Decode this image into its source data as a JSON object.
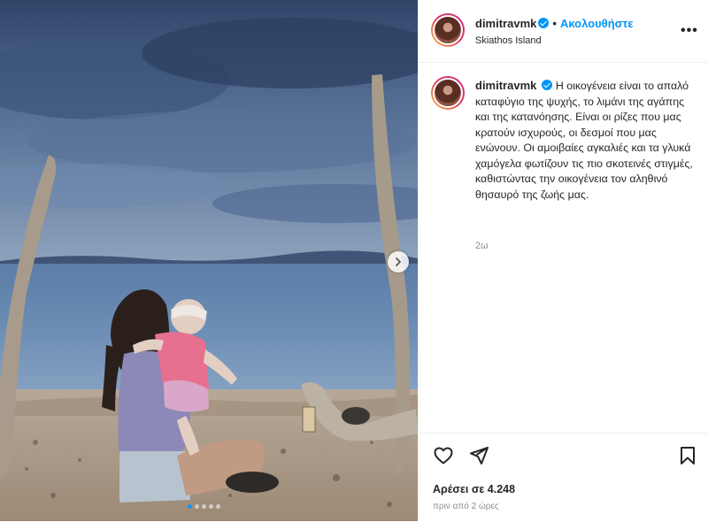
{
  "header": {
    "username": "dimitravmk",
    "separator": "•",
    "follow_label": "Ακολουθήστε",
    "location": "Skiathos Island",
    "more_label": "•••"
  },
  "caption": {
    "username": "dimitravmk",
    "text": "Η οικογένεια είναι το απαλό καταφύγιο της ψυχής, το λιμάνι της αγάπης και της κατανόησης. Είναι οι ρίζες που μας κρατούν ισχυρούς, οι δεσμοί που μας ενώνουν. Οι αμοιβαίες αγκαλιές και τα γλυκά χαμόγελα φωτίζουν τις πιο σκοτεινές στιγμές, καθιστώντας την οικογένεια τον αληθινό θησαυρό της ζωής μας.",
    "time": "2ω"
  },
  "actions": {
    "likes": "Αρέσει σε 4.248",
    "posted": "πριν από 2 ώρες"
  },
  "carousel": {
    "total": 5,
    "active": 1
  },
  "icons": {
    "like": "heart-icon",
    "share": "paper-plane-icon",
    "save": "bookmark-icon",
    "next": "chevron-right-icon",
    "verified": "verified-badge-icon"
  },
  "colors": {
    "accent": "#0095f6",
    "muted": "#8e8e8e"
  }
}
